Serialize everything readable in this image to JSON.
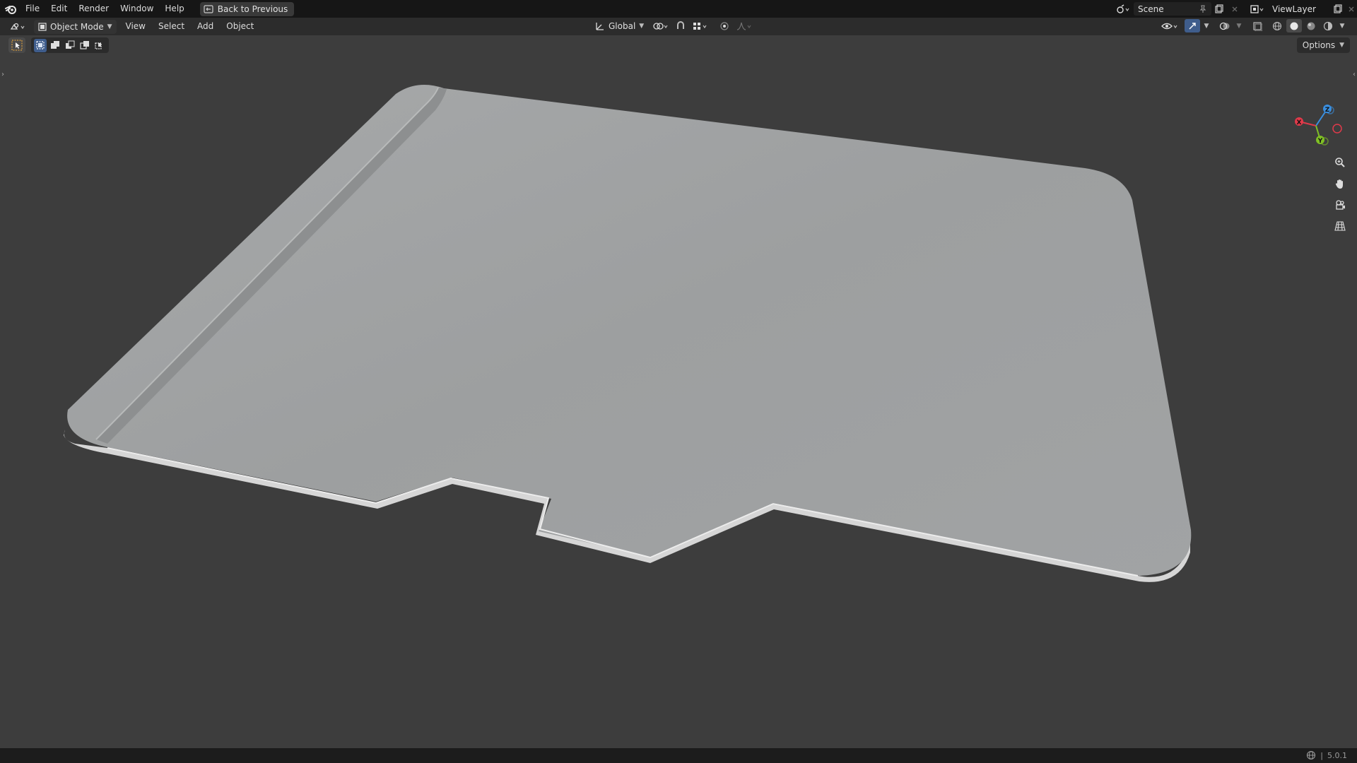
{
  "menu": {
    "items": [
      "File",
      "Edit",
      "Render",
      "Window",
      "Help"
    ],
    "back_button": "Back to Previous"
  },
  "top_right": {
    "scene_name": "Scene",
    "view_layer_name": "ViewLayer"
  },
  "header": {
    "mode": "Object Mode",
    "menus": [
      "View",
      "Select",
      "Add",
      "Object"
    ],
    "transform_orientation": "Global"
  },
  "tool_settings": {
    "options_label": "Options"
  },
  "status": {
    "version": "5.0.1"
  },
  "gizmo": {
    "x_label": "X",
    "y_label": "Y",
    "z_label": "Z",
    "x_color": "#e03a4a",
    "y_color": "#7fbf25",
    "z_color": "#3a8fe0"
  },
  "colors": {
    "viewport_bg": "#3d3d3d",
    "mesh_fill": "#9d9fa0"
  }
}
